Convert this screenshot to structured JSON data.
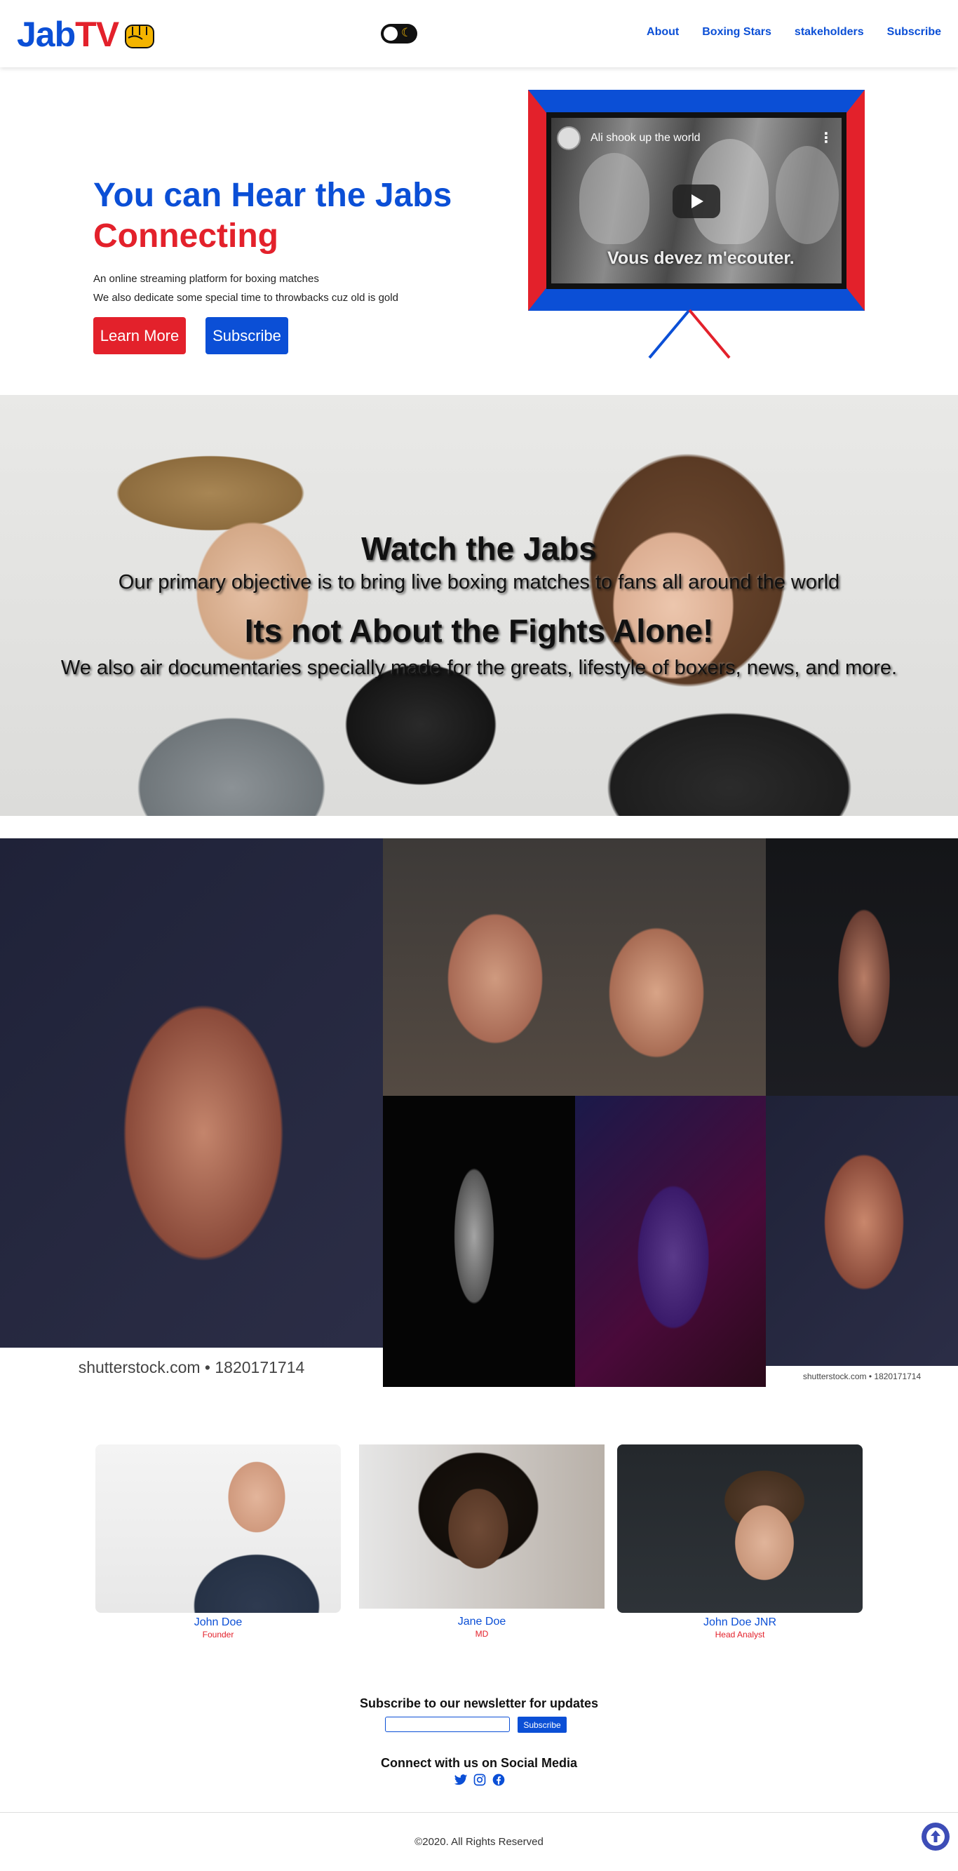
{
  "nav": {
    "logo_part1": "Jab",
    "logo_part2": "TV",
    "links": [
      "About",
      "Boxing Stars",
      "stakeholders",
      "Subscribe"
    ]
  },
  "hero": {
    "heading_line1": "You can Hear the Jabs",
    "heading_line2": "Connecting",
    "para_line1": "An online streaming platform for boxing matches",
    "para_line2": "We also dedicate some special time to throwbacks cuz old is gold",
    "learn_more": "Learn More",
    "subscribe": "Subscribe"
  },
  "video": {
    "title": "Ali shook up the world",
    "subtitle": "Vous devez m'ecouter."
  },
  "banner": {
    "title1": "Watch the Jabs",
    "text1": "Our primary objective is to bring live boxing matches to fans all around the world",
    "title2": "Its not About the Fights Alone!",
    "text2": "We also air documentaries specially made for the greats, lifestyle of boxers, news, and more."
  },
  "gallery": {
    "watermark_large": "shutterstock.com • 1820171714",
    "watermark_small": "shutterstock.com • 1820171714"
  },
  "team": [
    {
      "name": "John Doe",
      "role": "Founder"
    },
    {
      "name": "Jane Doe",
      "role": "MD"
    },
    {
      "name": "John Doe JNR",
      "role": "Head Analyst"
    }
  ],
  "newsletter": {
    "title": "Subscribe to our newsletter for updates",
    "button": "Subscribe"
  },
  "social": {
    "title": "Connect with us on Social Media",
    "icons": [
      "twitter-icon",
      "instagram-icon",
      "facebook-icon"
    ]
  },
  "footer": {
    "copyright": "©2020. All Rights Reserved"
  },
  "colors": {
    "brand_blue": "#0b4fd6",
    "brand_red": "#e3212b",
    "scroll_top": "#3d4db7"
  }
}
